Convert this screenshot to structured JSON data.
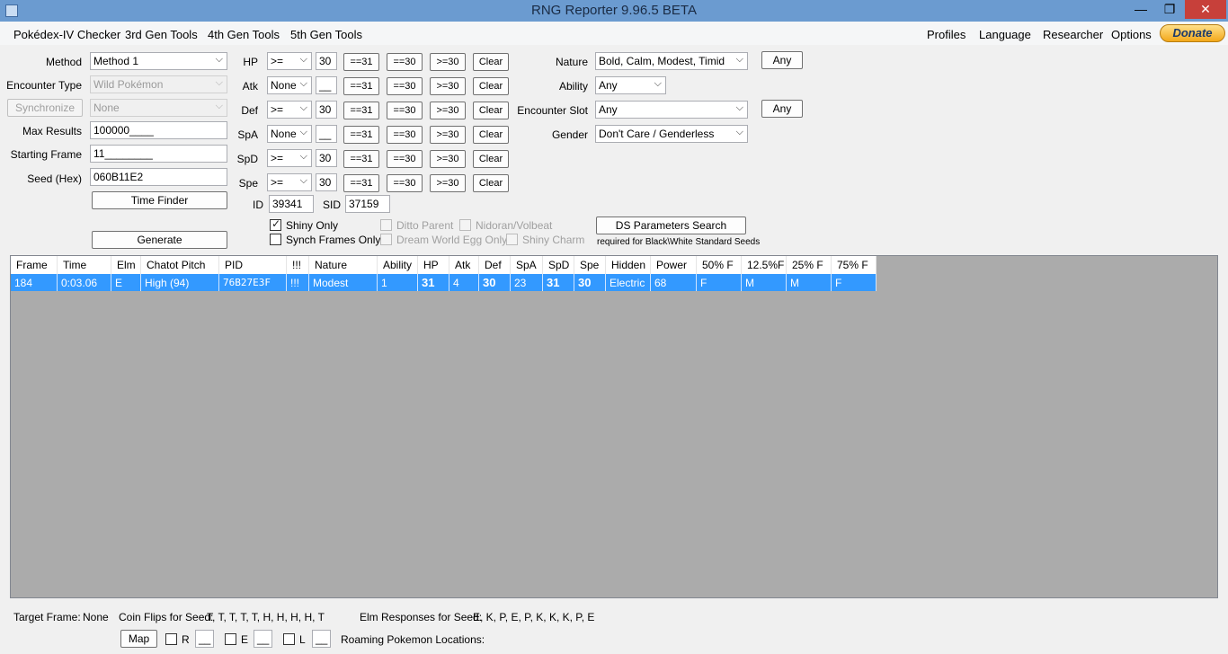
{
  "window": {
    "title": "RNG Reporter 9.96.5 BETA",
    "min": "—",
    "max": "❐",
    "close": "✕"
  },
  "menu": {
    "left": [
      "Pokédex-IV Checker",
      "3rd Gen Tools",
      "4th Gen Tools",
      "5th Gen Tools"
    ],
    "right": [
      "Profiles",
      "Language",
      "Researcher",
      "Options"
    ],
    "donate": "Donate"
  },
  "form": {
    "method_label": "Method",
    "method_value": "Method 1",
    "encounter_label": "Encounter Type",
    "encounter_value": "Wild Pokémon",
    "sync_button": "Synchronize",
    "sync_value": "None",
    "max_results_label": "Max Results",
    "max_results_value": "100000____",
    "starting_frame_label": "Starting Frame",
    "starting_frame_value": "11________",
    "seed_label": "Seed (Hex)",
    "seed_value": "060B11E2",
    "time_finder": "Time Finder",
    "generate": "Generate"
  },
  "ivs": [
    {
      "stat": "HP",
      "op": ">=",
      "value": "30"
    },
    {
      "stat": "Atk",
      "op": "None",
      "value": "__"
    },
    {
      "stat": "Def",
      "op": ">=",
      "value": "30"
    },
    {
      "stat": "SpA",
      "op": "None",
      "value": "__"
    },
    {
      "stat": "SpD",
      "op": ">=",
      "value": "30"
    },
    {
      "stat": "Spe",
      "op": ">=",
      "value": "30"
    }
  ],
  "iv_buttons": {
    "eq31": "==31",
    "eq30": "==30",
    "ge30": ">=30",
    "clear": "Clear"
  },
  "id_label": "ID",
  "id_value": "39341",
  "sid_label": "SID",
  "sid_value": "37159",
  "checks": {
    "shiny_only": "Shiny Only",
    "synch_frames": "Synch Frames Only",
    "ditto": "Ditto Parent",
    "dream_world": "Dream World Egg Only",
    "nidoran": "Nidoran/Volbeat",
    "shiny_charm": "Shiny Charm"
  },
  "right": {
    "nature_label": "Nature",
    "nature_value": "Bold, Calm, Modest, Timid",
    "ability_label": "Ability",
    "ability_value": "Any",
    "slot_label": "Encounter Slot",
    "slot_value": "Any",
    "gender_label": "Gender",
    "gender_value": "Don't Care / Genderless",
    "any_button": "Any",
    "ds_button": "DS Parameters Search",
    "ds_note": "required for Black\\White Standard Seeds"
  },
  "table": {
    "columns": [
      "Frame",
      "Time",
      "Elm",
      "Chatot Pitch",
      "PID",
      "!!!",
      "Nature",
      "Ability",
      "HP",
      "Atk",
      "Def",
      "SpA",
      "SpD",
      "Spe",
      "Hidden",
      "Power",
      "50% F",
      "12.5%F",
      "25% F",
      "75% F"
    ],
    "rows": [
      [
        "184",
        "0:03.06",
        "E",
        "High (94)",
        "76B27E3F",
        "!!!",
        "Modest",
        "1",
        "31",
        "4",
        "30",
        "23",
        "31",
        "30",
        "Electric",
        "68",
        "F",
        "M",
        "M",
        "F"
      ]
    ]
  },
  "footer": {
    "target_label": "Target Frame:",
    "target_value": "None",
    "coin_label": "Coin Flips for Seed:",
    "coin_value": "T, T, T, T, T, H, H, H, H, T",
    "elm_label": "Elm Responses for Seed:",
    "elm_value": "E, K, P, E, P, K, K, K, P, E",
    "map": "Map",
    "r": "R",
    "e": "E",
    "l": "L",
    "blank": "__",
    "roaming": "Roaming Pokemon Locations:"
  }
}
